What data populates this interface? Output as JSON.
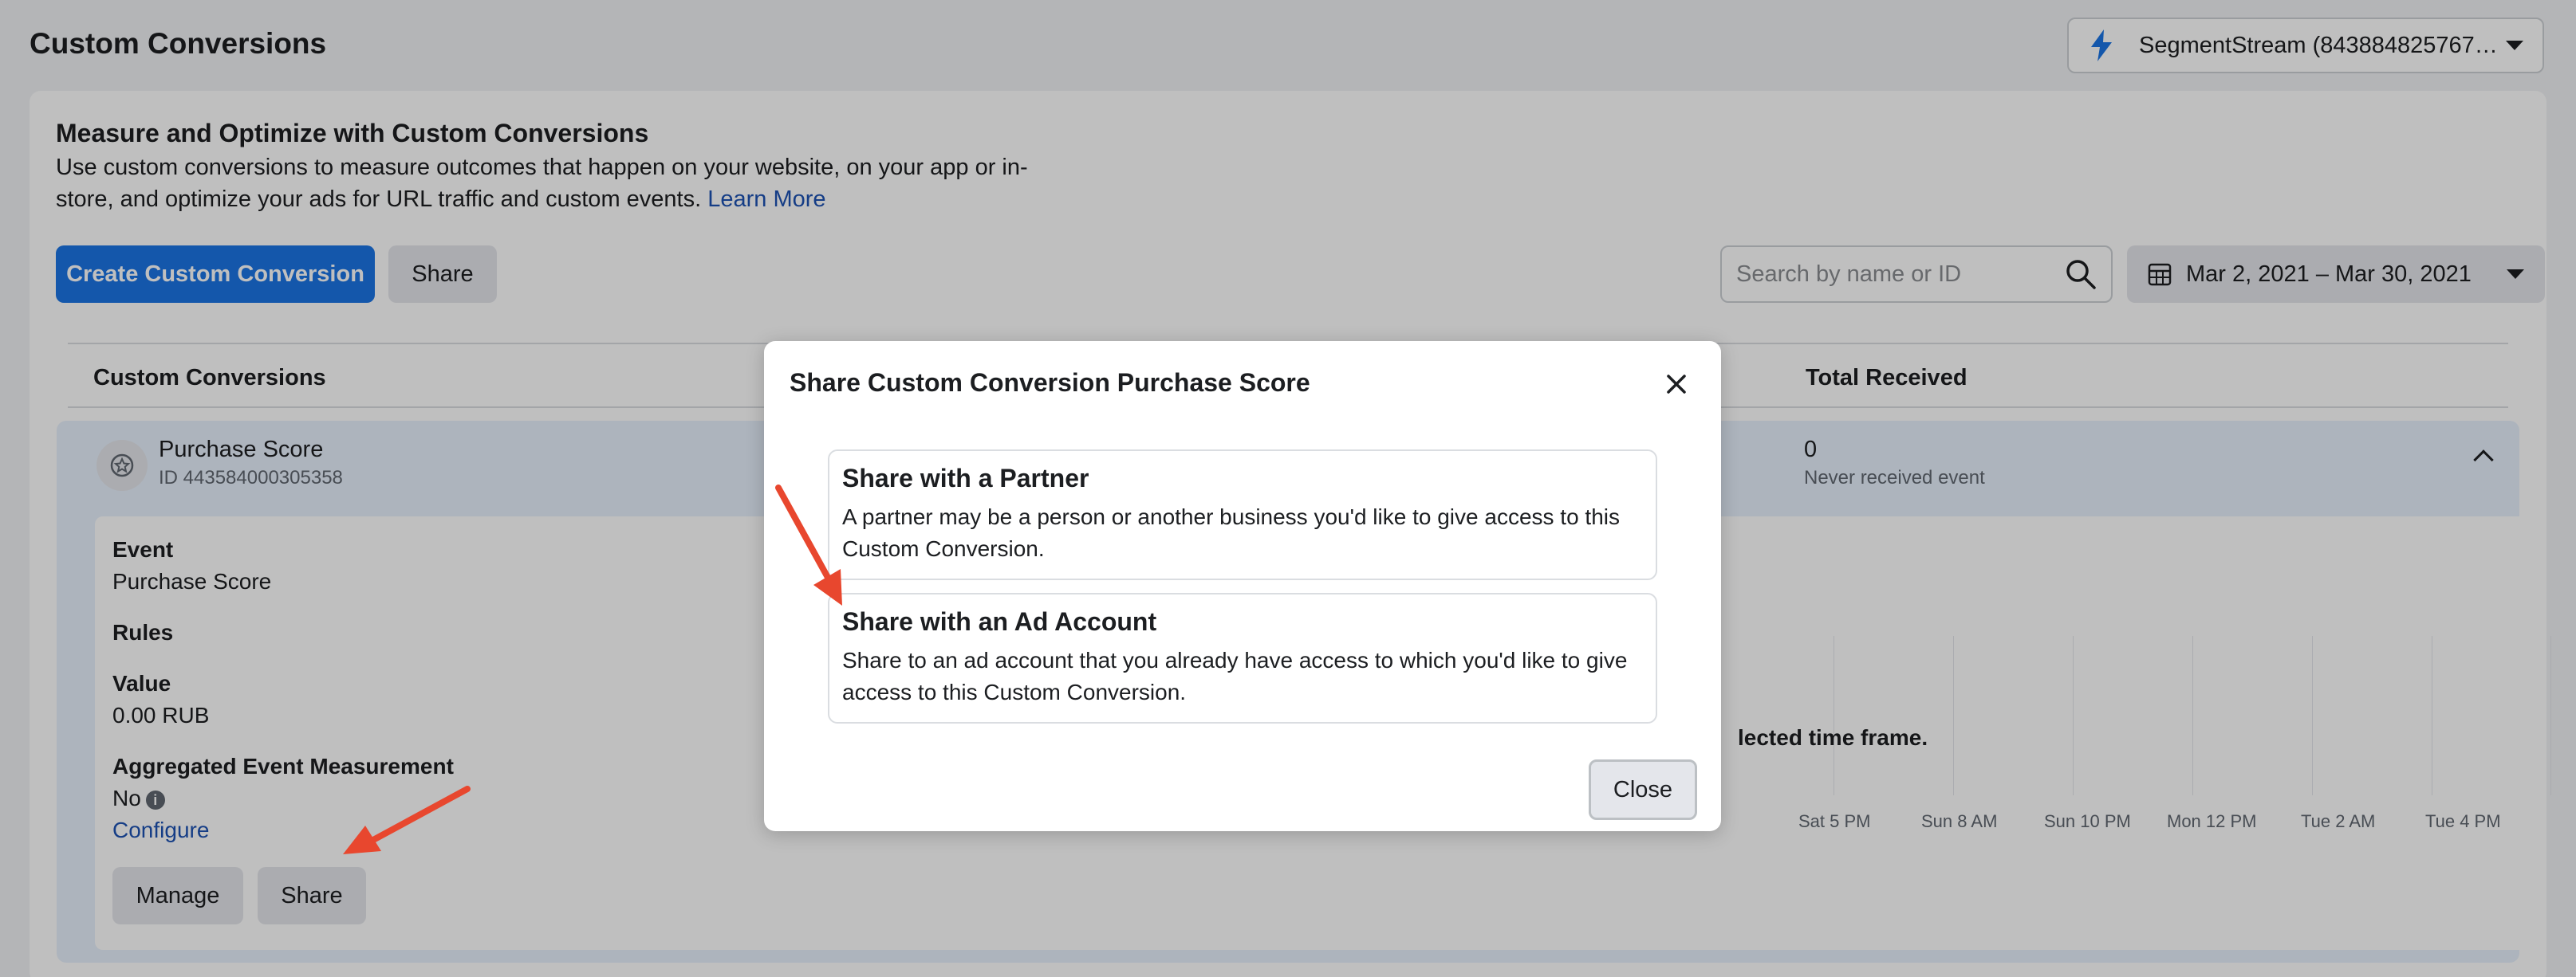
{
  "page": {
    "title": "Custom Conversions"
  },
  "account": {
    "name": "SegmentStream (843884825767…"
  },
  "intro": {
    "title": "Measure and Optimize with Custom Conversions",
    "text": "Use custom conversions to measure outcomes that happen on your website, on your app or in-store, and optimize your ads for URL traffic and custom events.",
    "learn_more": "Learn More"
  },
  "toolbar": {
    "create_label": "Create Custom Conversion",
    "share_label": "Share",
    "search_placeholder": "Search by name or ID",
    "date_range": "Mar 2, 2021 – Mar 30, 2021"
  },
  "table": {
    "headers": {
      "name": "Custom Conversions",
      "total": "Total Received"
    },
    "row": {
      "name": "Purchase Score",
      "id": "ID 443584000305358",
      "total": "0",
      "total_sub": "Never received event"
    }
  },
  "detail": {
    "event_label": "Event",
    "event_value": "Purchase Score",
    "rules_label": "Rules",
    "value_label": "Value",
    "value_value": "0.00 RUB",
    "aem_label": "Aggregated Event Measurement",
    "aem_value": "No",
    "configure": "Configure",
    "manage_label": "Manage",
    "share_label": "Share",
    "chart_message": "lected time frame.",
    "ticks": [
      "Sat 5 PM",
      "Sun 8 AM",
      "Sun 10 PM",
      "Mon 12 PM",
      "Tue 2 AM",
      "Tue 4 PM"
    ]
  },
  "modal": {
    "title": "Share Custom Conversion Purchase Score",
    "option1_title": "Share with a Partner",
    "option1_desc": "A partner may be a person or another business you'd like to give access to this Custom Conversion.",
    "option2_title": "Share with an Ad Account",
    "option2_desc": "Share to an ad account that you already have access to which you'd like to give access to this Custom Conversion.",
    "close_label": "Close"
  },
  "colors": {
    "accent": "#1b74e4",
    "arrow": "#e8472e",
    "link": "#1d52b3"
  }
}
